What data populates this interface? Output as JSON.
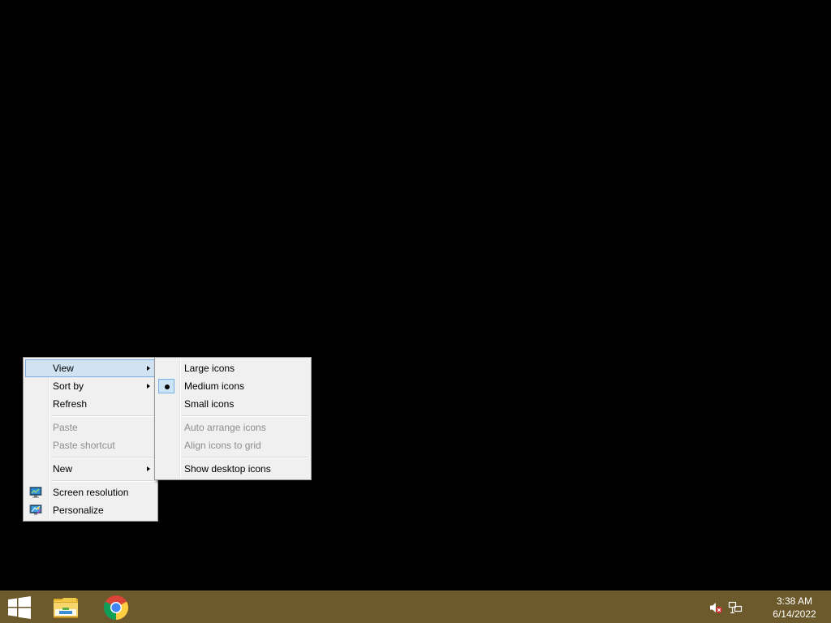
{
  "context_menu": {
    "items": [
      {
        "label": "View",
        "has_submenu": true,
        "highlighted": true
      },
      {
        "label": "Sort by",
        "has_submenu": true
      },
      {
        "label": "Refresh"
      },
      {
        "label": "Paste",
        "disabled": true
      },
      {
        "label": "Paste shortcut",
        "disabled": true
      },
      {
        "label": "New",
        "has_submenu": true
      },
      {
        "label": "Screen resolution",
        "icon": "screen-resolution-icon"
      },
      {
        "label": "Personalize",
        "icon": "personalize-icon"
      }
    ]
  },
  "view_submenu": {
    "items": [
      {
        "label": "Large icons"
      },
      {
        "label": "Medium icons",
        "selected": true
      },
      {
        "label": "Small icons"
      },
      {
        "label": "Auto arrange icons",
        "disabled": true
      },
      {
        "label": "Align icons to grid",
        "disabled": true
      },
      {
        "label": "Show desktop icons"
      }
    ]
  },
  "taskbar": {
    "buttons": [
      {
        "icon": "windows-logo-icon"
      },
      {
        "icon": "file-explorer-icon"
      },
      {
        "icon": "chrome-icon"
      }
    ],
    "tray": {
      "icons": [
        "volume-muted-icon",
        "network-icon"
      ]
    },
    "clock": {
      "time": "3:38 AM",
      "date": "6/14/2022"
    }
  },
  "colors": {
    "desktop_background": "#000000",
    "taskbar_background": "#6c5a2c",
    "menu_background": "#f0f0f0",
    "menu_highlight": "#d1e2f2",
    "menu_highlight_border": "#78aee5",
    "disabled_text": "#8d8d8d"
  }
}
